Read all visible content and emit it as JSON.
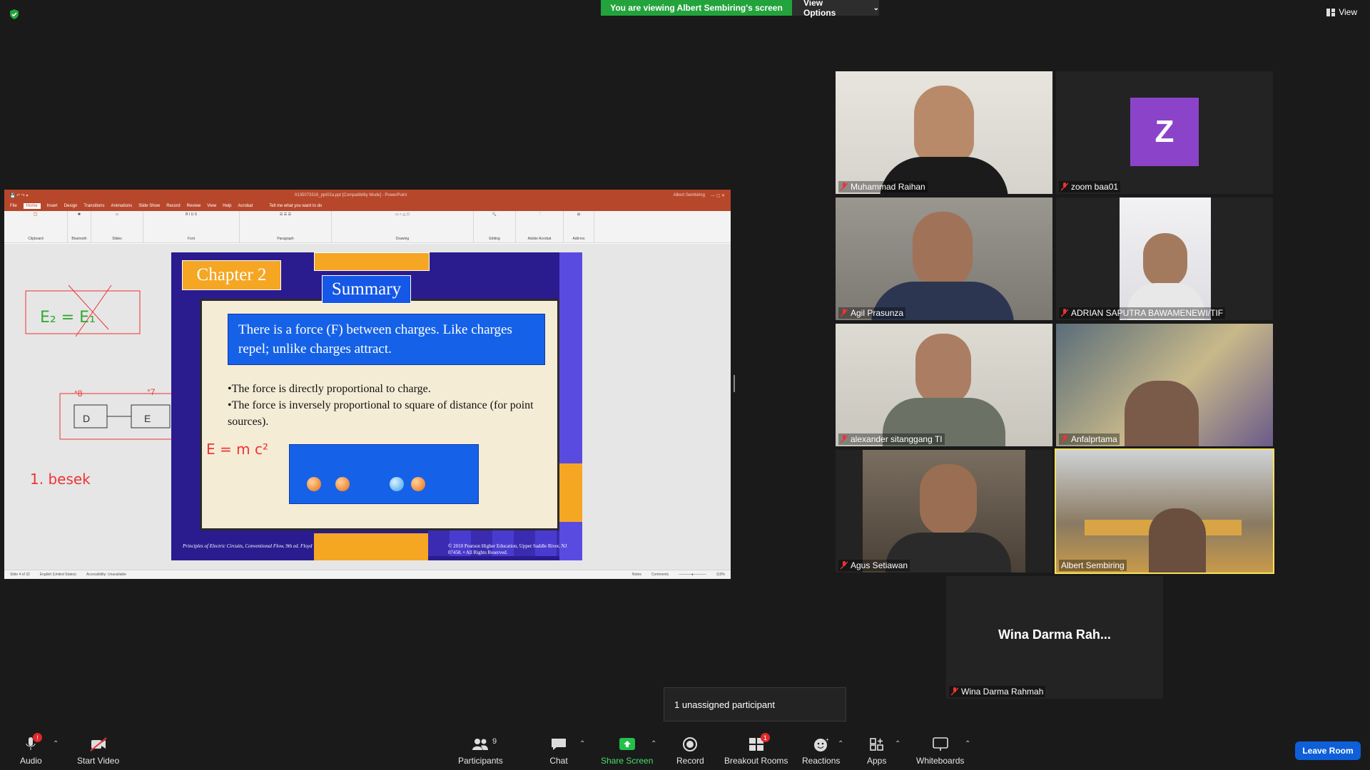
{
  "banner": {
    "viewing": "You are viewing Albert Sembiring's screen",
    "view_options": "View Options",
    "view": "View"
  },
  "ppt": {
    "window_title": "0135073316_ppt02a.ppt [Compatibility Mode] - PowerPoint",
    "user": "Albert Sembiring",
    "tabs": [
      "File",
      "Home",
      "Insert",
      "Design",
      "Transitions",
      "Animations",
      "Slide Show",
      "Record",
      "Review",
      "View",
      "Help",
      "Acrobat"
    ],
    "search": "Tell me what you want to do",
    "groups": [
      "Clipboard",
      "Bluetooth",
      "Slides",
      "Font",
      "Paragraph",
      "Drawing",
      "Editing",
      "Adobe Acrobat",
      "Add-ins"
    ],
    "status": {
      "slide": "Slide 4 of 32",
      "lang": "English (United States)",
      "access": "Accessibility: Unavailable",
      "notes": "Notes",
      "comments": "Comments",
      "zoom": "119%"
    }
  },
  "slide": {
    "chapter": "Chapter 2",
    "summary": "Summary",
    "box_text": "There is a force (F) between charges. Like charges repel; unlike charges attract.",
    "bullet1": "•The force is directly proportional to charge.",
    "bullet2": "•The force is inversely proportional to square of distance (for point sources).",
    "footer_left": "Principles of Electric Circuits, Conventional Flow, 9th ed. Floyd",
    "footer_right": "© 2010 Pearson Higher Education, Upper Saddle River, NJ 07458. • All Rights Reserved."
  },
  "ink": {
    "note": "1. besek",
    "formula": "E = m c²"
  },
  "participants": [
    {
      "name": "Muhammad Raihan"
    },
    {
      "name": "zoom baa01",
      "avatar_letter": "Z"
    },
    {
      "name": "Agil Prasunza"
    },
    {
      "name": "ADRIAN SAPUTRA BAWAMENEWI/TIF"
    },
    {
      "name": "alexander sitanggang TI"
    },
    {
      "name": "Anfalprtama"
    },
    {
      "name": "Agus Setiawan"
    },
    {
      "name": "Albert Sembiring"
    },
    {
      "name": "Wina Darma Rahmah",
      "big_name": "Wina Darma Rah..."
    }
  ],
  "tooltip": "1 unassigned participant",
  "toolbar": {
    "audio": "Audio",
    "start_video": "Start Video",
    "participants": "Participants",
    "participants_count": "9",
    "chat": "Chat",
    "share_screen": "Share Screen",
    "record": "Record",
    "breakout_rooms": "Breakout Rooms",
    "breakout_badge": "1",
    "audio_badge": "!",
    "reactions": "Reactions",
    "apps": "Apps",
    "whiteboards": "Whiteboards",
    "leave": "Leave Room"
  },
  "colors": {
    "share_green": "#23a33c",
    "ppt_red": "#b7472a",
    "active_speaker": "#f7e25a",
    "leave_blue": "#0e5fd8",
    "avatar_purple": "#8b44c9"
  }
}
